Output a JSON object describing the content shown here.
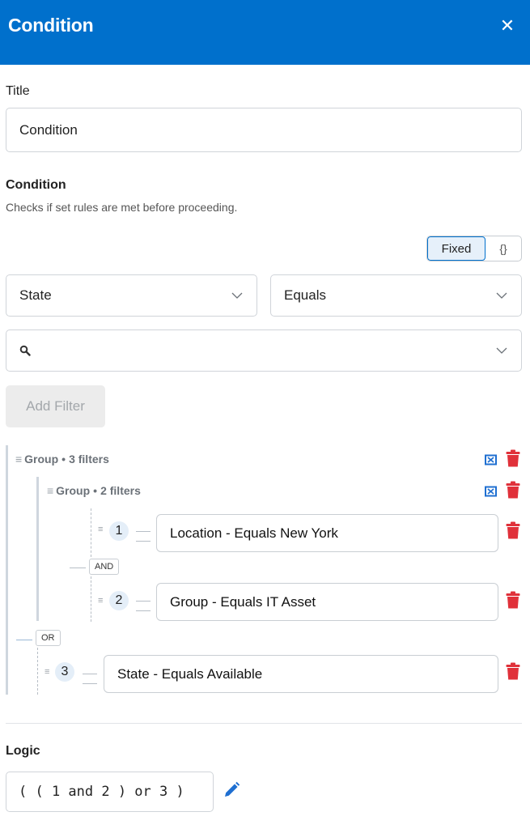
{
  "header": {
    "title": "Condition",
    "close_glyph": "✕"
  },
  "title_field": {
    "label": "Title",
    "value": "Condition"
  },
  "condition": {
    "heading": "Condition",
    "description": "Checks if set rules are met before proceeding.",
    "mode_toggle": {
      "fixed_label": "Fixed",
      "expression_label": "{}",
      "selected": "Fixed"
    },
    "field_select": {
      "value": "State"
    },
    "operator_select": {
      "value": "Equals"
    },
    "value_search": {
      "value": ""
    },
    "add_filter_label": "Add Filter"
  },
  "tree": {
    "root_group": {
      "label": "Group",
      "count_label": "3 filters"
    },
    "nested_group": {
      "label": "Group",
      "count_label": "2 filters"
    },
    "filters": [
      {
        "number": "1",
        "text": "Location - Equals New York"
      },
      {
        "number": "2",
        "text": "Group - Equals IT Asset"
      },
      {
        "number": "3",
        "text": "State - Equals Available"
      }
    ],
    "connectors": {
      "and": "AND",
      "or": "OR"
    },
    "dots": "≡",
    "separator": "•"
  },
  "logic": {
    "heading": "Logic",
    "expression": "( ( 1 and 2 ) or 3 )"
  },
  "colors": {
    "brand": "#0070cc",
    "danger": "#e0313a",
    "badge_bg": "#e4eef8"
  },
  "icons": {
    "close": "close-icon",
    "chevron": "chevron-down-icon",
    "search": "search-icon",
    "ungroup": "ungroup-icon",
    "trash": "trash-icon",
    "edit": "pencil-icon"
  }
}
